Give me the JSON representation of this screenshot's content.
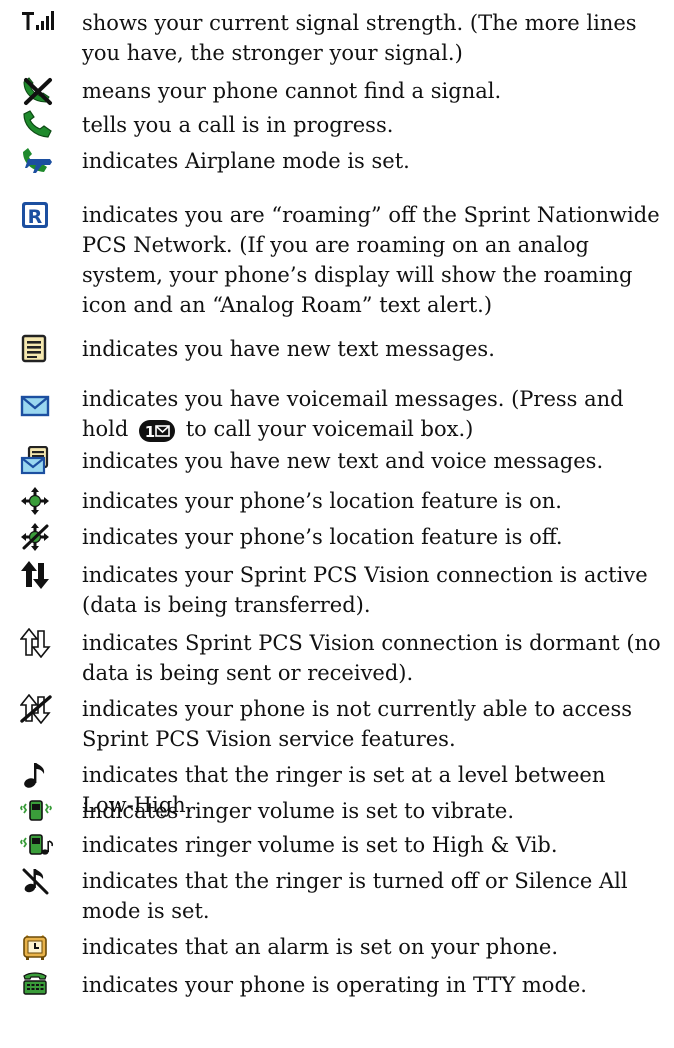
{
  "entries": [
    {
      "icon": "signal-strength-icon",
      "text": "shows your current signal strength. (The more lines you have, the stronger your signal.)"
    },
    {
      "icon": "no-signal-icon",
      "text": "means your phone cannot find a signal."
    },
    {
      "icon": "call-in-progress-icon",
      "text": "tells you a call is in progress."
    },
    {
      "icon": "airplane-mode-icon",
      "text": "indicates Airplane mode is set."
    },
    {
      "icon": "roaming-icon",
      "text": "indicates you are “roaming” off the Sprint Nationwide PCS Network. (If you are roaming on an analog system, your phone’s display will show the roaming icon and an “Analog Roam” text alert.)"
    },
    {
      "icon": "text-message-icon",
      "text": "indicates you have new text messages."
    },
    {
      "icon": "voicemail-icon",
      "text_before": "indicates you have voicemail messages. (Press and hold",
      "key_label": "1",
      "key_icon": "envelope-key-icon",
      "text_after": "to call your voicemail box.)"
    },
    {
      "icon": "text-and-voice-icon",
      "text": "indicates you have new text and voice messages."
    },
    {
      "icon": "location-on-icon",
      "text": "indicates your phone’s location feature is on."
    },
    {
      "icon": "location-off-icon",
      "text": "indicates your phone’s location feature is off."
    },
    {
      "icon": "vision-active-icon",
      "text": "indicates your Sprint PCS Vision connection is active (data is being transferred)."
    },
    {
      "icon": "vision-dormant-icon",
      "text": "indicates Sprint PCS Vision connection is dormant (no data is being sent or received)."
    },
    {
      "icon": "vision-unavailable-icon",
      "text": "indicates your phone is not currently able to access Sprint PCS Vision service features."
    },
    {
      "icon": "ringer-level-icon",
      "text": "indicates that the ringer is set at a level between Low-High."
    },
    {
      "icon": "vibrate-icon",
      "text": "indicates ringer volume is set to vibrate."
    },
    {
      "icon": "high-and-vib-icon",
      "text": "indicates ringer volume is set to High & Vib."
    },
    {
      "icon": "ringer-off-icon",
      "text": "indicates that the ringer is turned off or Silence All mode is set."
    },
    {
      "icon": "alarm-icon",
      "text": "indicates that an alarm is set on your phone."
    },
    {
      "icon": "tty-icon",
      "text": "indicates your phone is operating in TTY mode."
    }
  ]
}
